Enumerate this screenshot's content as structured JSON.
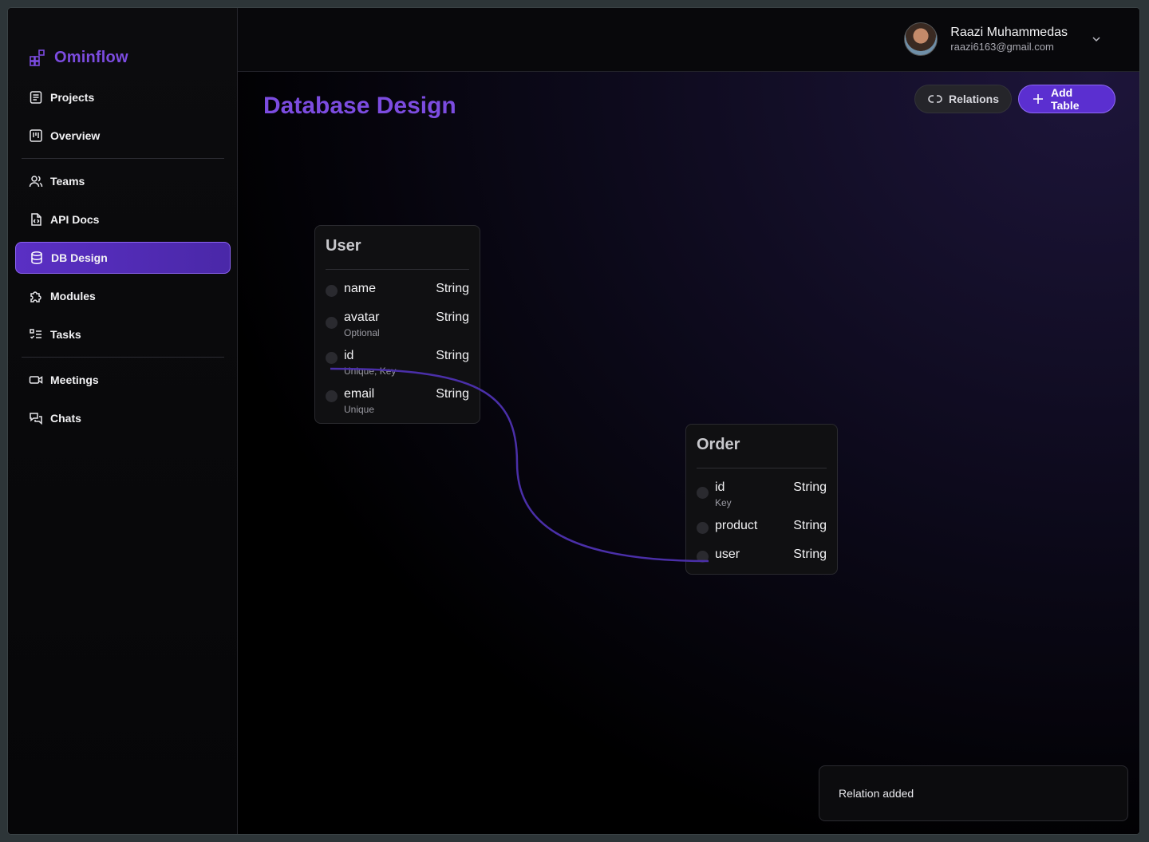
{
  "brand": {
    "name": "Ominflow",
    "icon": "grid-plus-icon"
  },
  "sidebar": {
    "items": [
      {
        "label": "Projects",
        "icon": "document-icon"
      },
      {
        "label": "Overview",
        "icon": "kanban-icon"
      },
      {
        "label": "Teams",
        "icon": "users-icon"
      },
      {
        "label": "API Docs",
        "icon": "code-file-icon"
      },
      {
        "label": "DB Design",
        "icon": "database-icon",
        "active": true
      },
      {
        "label": "Modules",
        "icon": "puzzle-icon"
      },
      {
        "label": "Tasks",
        "icon": "checklist-icon"
      },
      {
        "label": "Meetings",
        "icon": "video-icon"
      },
      {
        "label": "Chats",
        "icon": "chat-bubbles-icon"
      }
    ]
  },
  "user": {
    "name": "Raazi Muhammedas",
    "email": "raazi6163@gmail.com"
  },
  "page": {
    "title": "Database Design"
  },
  "toolbar": {
    "relations_label": "Relations",
    "add_table_label": "Add Table"
  },
  "tables": [
    {
      "name": "User",
      "fields": [
        {
          "name": "name",
          "type": "String",
          "meta": ""
        },
        {
          "name": "avatar",
          "type": "String",
          "meta": "Optional"
        },
        {
          "name": "id",
          "type": "String",
          "meta": "Unique, Key"
        },
        {
          "name": "email",
          "type": "String",
          "meta": "Unique"
        }
      ]
    },
    {
      "name": "Order",
      "fields": [
        {
          "name": "id",
          "type": "String",
          "meta": "Key"
        },
        {
          "name": "product",
          "type": "String",
          "meta": ""
        },
        {
          "name": "user",
          "type": "String",
          "meta": ""
        }
      ]
    }
  ],
  "relation": {
    "from": "User.id",
    "to": "Order.user"
  },
  "toast": {
    "message": "Relation added"
  },
  "colors": {
    "accent": "#7c4ce0",
    "button": "#5b2fd0",
    "relation_line": "#4a2fa8"
  }
}
